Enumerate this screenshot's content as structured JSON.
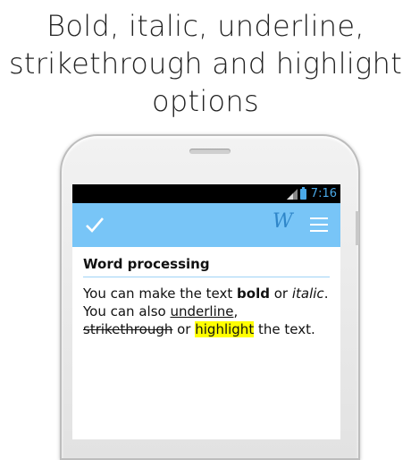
{
  "caption": {
    "line1": "Bold, italic, underline,",
    "line2": "strikethrough and highlight",
    "line3": "options"
  },
  "status_bar": {
    "time": "7:16"
  },
  "toolbar": {
    "logo": "W",
    "check_icon": "check-icon",
    "menu_icon": "hamburger-menu-icon",
    "color": "#78c5f7"
  },
  "document": {
    "title": "Word processing",
    "p1_a": "You can make the text ",
    "p1_bold": "bold",
    "p1_b": " or ",
    "p1_italic": "italic",
    "p1_c": ".",
    "p2_a": "You can also ",
    "p2_underline": "underline",
    "p2_b": ",",
    "p3_strike": "strikethrough",
    "p3_a": " or ",
    "p3_highlight": "highlight",
    "p3_b": " the text."
  }
}
